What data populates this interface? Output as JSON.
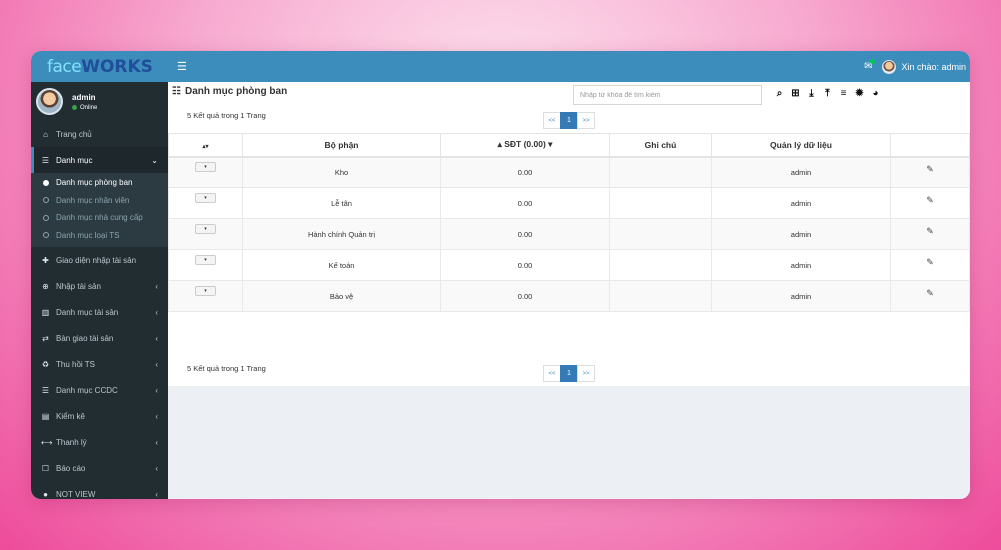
{
  "logo": {
    "part1": "face",
    "part2": "WORKS"
  },
  "header": {
    "menu_icon": "☰",
    "greeting": "Xin chào: admin",
    "mail_icon": "mail-icon"
  },
  "user": {
    "name": "admin",
    "status": "Online"
  },
  "sidebar": {
    "items": [
      {
        "label": "Trang chủ",
        "icon": "⌂",
        "chevron": ""
      },
      {
        "label": "Danh mục",
        "icon": "☰",
        "chevron": "⌄",
        "active": true
      },
      {
        "label": "Giao diện nhập tài sản",
        "icon": "✚",
        "chevron": ""
      },
      {
        "label": "Nhập tài sản",
        "icon": "⊕",
        "chevron": "‹"
      },
      {
        "label": "Danh mục tài sản",
        "icon": "▥",
        "chevron": "‹"
      },
      {
        "label": "Bàn giao tài sản",
        "icon": "⇄",
        "chevron": "‹"
      },
      {
        "label": "Thu hồi TS",
        "icon": "♻",
        "chevron": "‹"
      },
      {
        "label": "Danh mục CCDC",
        "icon": "☰",
        "chevron": "‹"
      },
      {
        "label": "Kiểm kê",
        "icon": "▤",
        "chevron": "‹"
      },
      {
        "label": "Thanh lý",
        "icon": "⟷",
        "chevron": "‹"
      },
      {
        "label": "Báo cáo",
        "icon": "☐",
        "chevron": "‹"
      },
      {
        "label": "NOT VIEW",
        "icon": "●",
        "chevron": "‹"
      }
    ],
    "submenu": [
      {
        "label": "Danh mục phòng ban",
        "active": true
      },
      {
        "label": "Danh mục nhân viên"
      },
      {
        "label": "Danh mục nhà cung cấp"
      },
      {
        "label": "Danh mục loại TS"
      }
    ]
  },
  "page": {
    "title": "Danh mục phòng ban",
    "search_placeholder": "Nhập từ khóa để tìm kiếm",
    "result_text": "5 Kết quả trong 1 Trang",
    "pager": {
      "prev": "<<",
      "current": "1",
      "next": ">>"
    }
  },
  "table": {
    "sort_icon": "▴▾",
    "headers": [
      "Bộ phận",
      "▴ SĐT (0.00) ▾",
      "Ghi chú",
      "Quản lý dữ liệu",
      ""
    ],
    "dropdown": "▾",
    "edit_icon": "✎",
    "rows": [
      {
        "bo_phan": "Kho",
        "sdt": "0.00",
        "ghi_chu": "",
        "quan_ly": "admin"
      },
      {
        "bo_phan": "Lễ tân",
        "sdt": "0.00",
        "ghi_chu": "",
        "quan_ly": "admin"
      },
      {
        "bo_phan": "Hành chính Quản trị",
        "sdt": "0.00",
        "ghi_chu": "",
        "quan_ly": "admin"
      },
      {
        "bo_phan": "Kế toán",
        "sdt": "0.00",
        "ghi_chu": "",
        "quan_ly": "admin"
      },
      {
        "bo_phan": "Bảo vệ",
        "sdt": "0.00",
        "ghi_chu": "",
        "quan_ly": "admin"
      }
    ]
  },
  "toolbar_icons": [
    "search-icon",
    "add-icon",
    "download-icon",
    "upload-icon",
    "list-icon",
    "settings-icon",
    "chart-pie-icon"
  ],
  "colors": {
    "header": "#3c8dbc",
    "sidebar": "#222d32",
    "accent": "#337ab7"
  }
}
